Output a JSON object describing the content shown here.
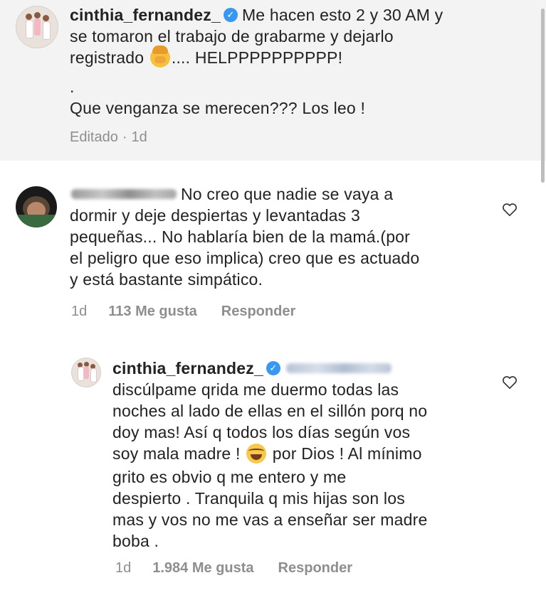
{
  "caption": {
    "username": "cinthia_fernandez_",
    "line1": "Me hacen esto 2 y 30 AM  y",
    "line2": "se tomaron el trabajo de grabarme y dejarlo",
    "line3a": "registrado",
    "line3b": ".... HELPPPPPPPPPP!",
    "line4": ".",
    "line5": "Que venganza se merecen??? Los leo !",
    "edited": "Editado",
    "dot": "·",
    "time": "1d",
    "emoji": "facepalm-emoji"
  },
  "comment": {
    "line1": "No creo que nadie se vaya a",
    "line2": "dormir y deje despiertas y levantadas 3",
    "line3": "pequeñas... No hablaría bien de la mamá.(por",
    "line4": "el peligro que eso implica) creo que es actuado",
    "line5": "y está bastante simpático.",
    "time": "1d",
    "likes": "113 Me gusta",
    "reply": "Responder",
    "icon": "heart-icon"
  },
  "reply": {
    "username": "cinthia_fernandez_",
    "lines": [
      "discúlpame qrida me duermo todas las",
      "noches al lado de ellas en el sillón porq no",
      "doy mas! Así q todos los días según vos",
      "soy mala madre !",
      "grito es obvio q me entero y me",
      "despierto . Tranquila q mis hijas son los",
      "mas y vos no me vas a enseñar ser madre",
      "boba ."
    ],
    "line4b": "por Dios ! Al mínimo",
    "time": "1d",
    "likes": "1.984 Me gusta",
    "reply": "Responder",
    "emoji": "laughing-tears-emoji",
    "icon": "heart-icon"
  },
  "colors": {
    "verified": "#3897f0",
    "meta": "#8e8e8e",
    "caption_bg": "#f3f3f3"
  }
}
